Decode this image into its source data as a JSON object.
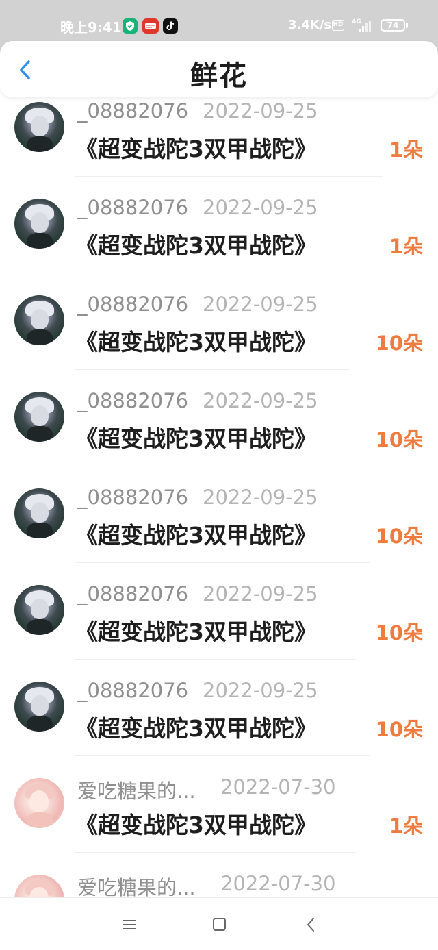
{
  "status_bar": {
    "time": "晚上9:41",
    "net_speed": "3.4K/s",
    "hd": "HD",
    "network": "4G",
    "battery": "74"
  },
  "header": {
    "title": "鲜花",
    "back_icon": "chevron-left-icon",
    "accent_color": "#2f8ff0"
  },
  "records": [
    {
      "user": "_08882076",
      "date": "2022-09-25",
      "book": "《超变战陀3双甲战陀》",
      "count": "1朵",
      "avatar": "dark"
    },
    {
      "user": "_08882076",
      "date": "2022-09-25",
      "book": "《超变战陀3双甲战陀》",
      "count": "1朵",
      "avatar": "dark"
    },
    {
      "user": "_08882076",
      "date": "2022-09-25",
      "book": "《超变战陀3双甲战陀》",
      "count": "10朵",
      "avatar": "dark"
    },
    {
      "user": "_08882076",
      "date": "2022-09-25",
      "book": "《超变战陀3双甲战陀》",
      "count": "10朵",
      "avatar": "dark"
    },
    {
      "user": "_08882076",
      "date": "2022-09-25",
      "book": "《超变战陀3双甲战陀》",
      "count": "10朵",
      "avatar": "dark"
    },
    {
      "user": "_08882076",
      "date": "2022-09-25",
      "book": "《超变战陀3双甲战陀》",
      "count": "10朵",
      "avatar": "dark"
    },
    {
      "user": "_08882076",
      "date": "2022-09-25",
      "book": "《超变战陀3双甲战陀》",
      "count": "10朵",
      "avatar": "dark"
    },
    {
      "user": "爱吃糖果的...",
      "date": "2022-07-30",
      "book": "《超变战陀3双甲战陀》",
      "count": "1朵",
      "avatar": "pink"
    },
    {
      "user": "爱吃糖果的...",
      "date": "2022-07-30",
      "book": "",
      "count": "",
      "avatar": "pink"
    }
  ],
  "colors": {
    "count": "#ef7b3e",
    "username": "#8f8f8f",
    "date": "#b4b4b4",
    "book": "#1e1e1e"
  },
  "navbar": {
    "menu_icon": "menu-icon",
    "home_icon": "square-home-icon",
    "back_icon": "triangle-back-icon"
  }
}
